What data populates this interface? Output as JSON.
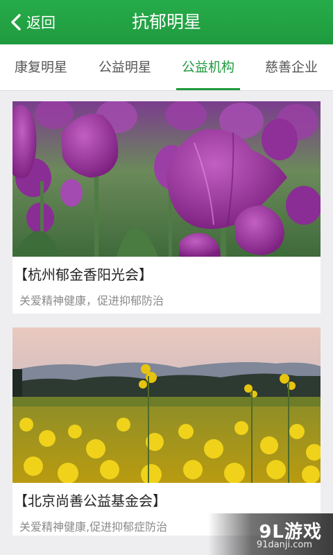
{
  "header": {
    "back_label": "返回",
    "title": "抗郁明星"
  },
  "tabs": [
    {
      "label": "康复明星",
      "active": false
    },
    {
      "label": "公益明星",
      "active": false
    },
    {
      "label": "公益机构",
      "active": true
    },
    {
      "label": "慈善企业",
      "active": false
    }
  ],
  "cards": [
    {
      "image": "purple-tulips-photo",
      "title": "【杭州郁金香阳光会】",
      "subtitle": "关爱精神健康，促进抑郁防治"
    },
    {
      "image": "rapeseed-flower-field-photo",
      "title": "【北京尚善公益基金会】",
      "subtitle": "关爱精神健康,促进抑郁症防治"
    }
  ],
  "watermark": {
    "logo": "9L游戏",
    "url": "91danji.com"
  },
  "colors": {
    "brand_green": "#1f9a3e",
    "background": "#eeeef0"
  }
}
